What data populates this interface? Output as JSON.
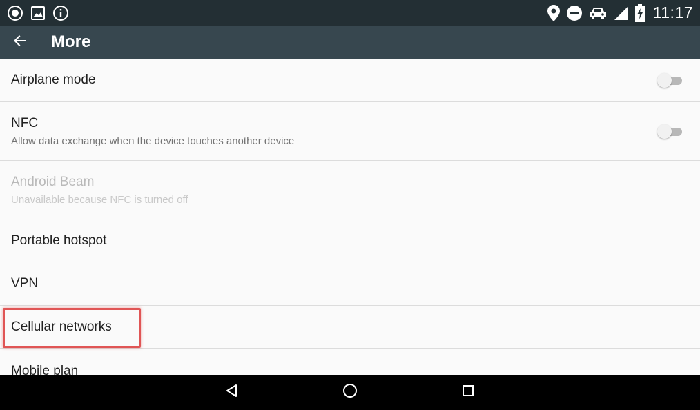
{
  "status_bar": {
    "time": "11:17",
    "left_icons": [
      "record-icon",
      "image-icon",
      "info-icon"
    ],
    "right_icons": [
      "location-icon",
      "do-not-disturb-icon",
      "car-icon",
      "signal-icon",
      "battery-charging-icon"
    ]
  },
  "app_bar": {
    "title": "More",
    "back_icon": "arrow-back-icon"
  },
  "settings": {
    "items": [
      {
        "title": "Airplane mode",
        "toggle": "off"
      },
      {
        "title": "NFC",
        "summary": "Allow data exchange when the device touches another device",
        "toggle": "off"
      },
      {
        "title": "Android Beam",
        "summary": "Unavailable because NFC is turned off",
        "disabled": true
      },
      {
        "title": "Portable hotspot"
      },
      {
        "title": "VPN"
      },
      {
        "title": "Cellular networks",
        "highlighted": true
      },
      {
        "title": "Mobile plan"
      }
    ]
  },
  "nav_bar": {
    "icons": [
      "nav-back-icon",
      "nav-home-icon",
      "nav-recents-icon"
    ]
  },
  "colors": {
    "status_bar": "#232f34",
    "app_bar": "#37474f",
    "background": "#fafafa",
    "highlight": "#e05555",
    "nav_bar": "#000000"
  }
}
